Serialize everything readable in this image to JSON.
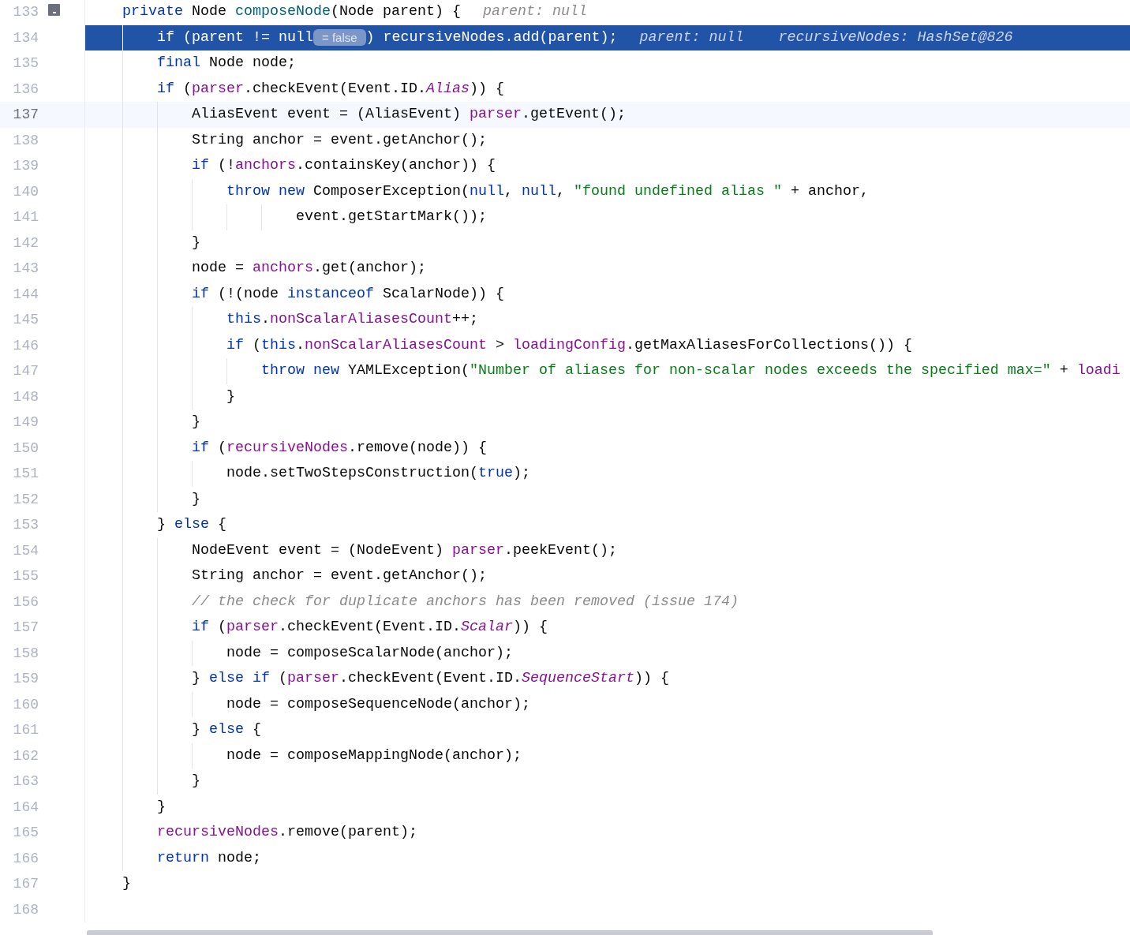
{
  "editor": {
    "lines": [
      {
        "number": "133",
        "executing": false,
        "caret_line": false,
        "gutter_marker": true,
        "segments": [
          {
            "kind": "code",
            "tokens": [
              {
                "kind": "keyword",
                "text": "    private"
              },
              {
                "kind": "plain",
                "text": " Node "
              },
              {
                "kind": "declaration",
                "text": "composeNode"
              },
              {
                "kind": "plain",
                "text": "(Node parent) {"
              }
            ]
          },
          {
            "kind": "inline_value",
            "text": "parent: null"
          }
        ]
      },
      {
        "number": "134",
        "executing": true,
        "caret_line": false,
        "gutter_marker": false,
        "segments": [
          {
            "kind": "code",
            "tokens": [
              {
                "kind": "keyword",
                "text": "        if"
              },
              {
                "kind": "plain",
                "text": " (parent != "
              },
              {
                "kind": "keyword",
                "text": "null"
              }
            ]
          },
          {
            "kind": "chip",
            "text": "= false"
          },
          {
            "kind": "code",
            "tokens": [
              {
                "kind": "plain",
                "text": ") "
              },
              {
                "kind": "field",
                "text": "recursiveNodes"
              },
              {
                "kind": "plain",
                "text": ".add(parent);"
              }
            ]
          },
          {
            "kind": "inline_value",
            "text": "parent: null"
          },
          {
            "kind": "inline_value",
            "text": "recursiveNodes: HashSet@826"
          }
        ]
      },
      {
        "number": "135",
        "executing": false,
        "caret_line": false,
        "gutter_marker": false,
        "segments": [
          {
            "kind": "code",
            "tokens": [
              {
                "kind": "keyword",
                "text": "        final"
              },
              {
                "kind": "plain",
                "text": " Node node;"
              }
            ]
          }
        ]
      },
      {
        "number": "136",
        "executing": false,
        "caret_line": false,
        "gutter_marker": false,
        "segments": [
          {
            "kind": "code",
            "tokens": [
              {
                "kind": "keyword",
                "text": "        if"
              },
              {
                "kind": "plain",
                "text": " ("
              },
              {
                "kind": "field",
                "text": "parser"
              },
              {
                "kind": "plain",
                "text": ".checkEvent(Event.ID."
              },
              {
                "kind": "static",
                "text": "Alias"
              },
              {
                "kind": "plain",
                "text": ")) {"
              }
            ]
          }
        ]
      },
      {
        "number": "137",
        "executing": false,
        "caret_line": true,
        "gutter_marker": false,
        "segments": [
          {
            "kind": "code",
            "tokens": [
              {
                "kind": "plain",
                "text": "            AliasEvent event = (AliasEvent) "
              },
              {
                "kind": "field",
                "text": "parser"
              },
              {
                "kind": "plain",
                "text": ".getEvent();"
              }
            ]
          }
        ]
      },
      {
        "number": "138",
        "executing": false,
        "caret_line": false,
        "gutter_marker": false,
        "segments": [
          {
            "kind": "code",
            "tokens": [
              {
                "kind": "plain",
                "text": "            String anchor = event.getAnchor();"
              }
            ]
          }
        ]
      },
      {
        "number": "139",
        "executing": false,
        "caret_line": false,
        "gutter_marker": false,
        "segments": [
          {
            "kind": "code",
            "tokens": [
              {
                "kind": "keyword",
                "text": "            if"
              },
              {
                "kind": "plain",
                "text": " (!"
              },
              {
                "kind": "field",
                "text": "anchors"
              },
              {
                "kind": "plain",
                "text": ".containsKey(anchor)) {"
              }
            ]
          }
        ]
      },
      {
        "number": "140",
        "executing": false,
        "caret_line": false,
        "gutter_marker": false,
        "segments": [
          {
            "kind": "code",
            "tokens": [
              {
                "kind": "keyword",
                "text": "                throw"
              },
              {
                "kind": "keyword",
                "text": " new"
              },
              {
                "kind": "plain",
                "text": " ComposerException("
              },
              {
                "kind": "keyword",
                "text": "null"
              },
              {
                "kind": "plain",
                "text": ", "
              },
              {
                "kind": "keyword",
                "text": "null"
              },
              {
                "kind": "plain",
                "text": ", "
              },
              {
                "kind": "string",
                "text": "\"found undefined alias \""
              },
              {
                "kind": "plain",
                "text": " + anchor,"
              }
            ]
          }
        ]
      },
      {
        "number": "141",
        "executing": false,
        "caret_line": false,
        "gutter_marker": false,
        "segments": [
          {
            "kind": "code",
            "tokens": [
              {
                "kind": "plain",
                "text": "                        event.getStartMark());"
              }
            ]
          }
        ]
      },
      {
        "number": "142",
        "executing": false,
        "caret_line": false,
        "gutter_marker": false,
        "segments": [
          {
            "kind": "code",
            "tokens": [
              {
                "kind": "plain",
                "text": "            }"
              }
            ]
          }
        ]
      },
      {
        "number": "143",
        "executing": false,
        "caret_line": false,
        "gutter_marker": false,
        "segments": [
          {
            "kind": "code",
            "tokens": [
              {
                "kind": "plain",
                "text": "            node = "
              },
              {
                "kind": "field",
                "text": "anchors"
              },
              {
                "kind": "plain",
                "text": ".get(anchor);"
              }
            ]
          }
        ]
      },
      {
        "number": "144",
        "executing": false,
        "caret_line": false,
        "gutter_marker": false,
        "segments": [
          {
            "kind": "code",
            "tokens": [
              {
                "kind": "keyword",
                "text": "            if"
              },
              {
                "kind": "plain",
                "text": " (!(node "
              },
              {
                "kind": "keyword",
                "text": "instanceof"
              },
              {
                "kind": "plain",
                "text": " ScalarNode)) {"
              }
            ]
          }
        ]
      },
      {
        "number": "145",
        "executing": false,
        "caret_line": false,
        "gutter_marker": false,
        "segments": [
          {
            "kind": "code",
            "tokens": [
              {
                "kind": "keyword",
                "text": "                this"
              },
              {
                "kind": "plain",
                "text": "."
              },
              {
                "kind": "field",
                "text": "nonScalarAliasesCount"
              },
              {
                "kind": "plain",
                "text": "++;"
              }
            ]
          }
        ]
      },
      {
        "number": "146",
        "executing": false,
        "caret_line": false,
        "gutter_marker": false,
        "segments": [
          {
            "kind": "code",
            "tokens": [
              {
                "kind": "keyword",
                "text": "                if"
              },
              {
                "kind": "plain",
                "text": " ("
              },
              {
                "kind": "keyword",
                "text": "this"
              },
              {
                "kind": "plain",
                "text": "."
              },
              {
                "kind": "field",
                "text": "nonScalarAliasesCount"
              },
              {
                "kind": "plain",
                "text": " > "
              },
              {
                "kind": "field",
                "text": "loadingConfig"
              },
              {
                "kind": "plain",
                "text": ".getMaxAliasesForCollections()) {"
              }
            ]
          }
        ]
      },
      {
        "number": "147",
        "executing": false,
        "caret_line": false,
        "gutter_marker": false,
        "segments": [
          {
            "kind": "code",
            "tokens": [
              {
                "kind": "keyword",
                "text": "                    throw"
              },
              {
                "kind": "keyword",
                "text": " new"
              },
              {
                "kind": "plain",
                "text": " YAMLException("
              },
              {
                "kind": "string",
                "text": "\"Number of aliases for non-scalar nodes exceeds the specified max=\""
              },
              {
                "kind": "plain",
                "text": " + "
              },
              {
                "kind": "field",
                "text": "loadi"
              }
            ]
          }
        ]
      },
      {
        "number": "148",
        "executing": false,
        "caret_line": false,
        "gutter_marker": false,
        "segments": [
          {
            "kind": "code",
            "tokens": [
              {
                "kind": "plain",
                "text": "                }"
              }
            ]
          }
        ]
      },
      {
        "number": "149",
        "executing": false,
        "caret_line": false,
        "gutter_marker": false,
        "segments": [
          {
            "kind": "code",
            "tokens": [
              {
                "kind": "plain",
                "text": "            }"
              }
            ]
          }
        ]
      },
      {
        "number": "150",
        "executing": false,
        "caret_line": false,
        "gutter_marker": false,
        "segments": [
          {
            "kind": "code",
            "tokens": [
              {
                "kind": "keyword",
                "text": "            if"
              },
              {
                "kind": "plain",
                "text": " ("
              },
              {
                "kind": "field",
                "text": "recursiveNodes"
              },
              {
                "kind": "plain",
                "text": ".remove(node)) {"
              }
            ]
          }
        ]
      },
      {
        "number": "151",
        "executing": false,
        "caret_line": false,
        "gutter_marker": false,
        "segments": [
          {
            "kind": "code",
            "tokens": [
              {
                "kind": "plain",
                "text": "                node.setTwoStepsConstruction("
              },
              {
                "kind": "keyword",
                "text": "true"
              },
              {
                "kind": "plain",
                "text": ");"
              }
            ]
          }
        ]
      },
      {
        "number": "152",
        "executing": false,
        "caret_line": false,
        "gutter_marker": false,
        "segments": [
          {
            "kind": "code",
            "tokens": [
              {
                "kind": "plain",
                "text": "            }"
              }
            ]
          }
        ]
      },
      {
        "number": "153",
        "executing": false,
        "caret_line": false,
        "gutter_marker": false,
        "segments": [
          {
            "kind": "code",
            "tokens": [
              {
                "kind": "plain",
                "text": "        } "
              },
              {
                "kind": "keyword",
                "text": "else"
              },
              {
                "kind": "plain",
                "text": " {"
              }
            ]
          }
        ]
      },
      {
        "number": "154",
        "executing": false,
        "caret_line": false,
        "gutter_marker": false,
        "segments": [
          {
            "kind": "code",
            "tokens": [
              {
                "kind": "plain",
                "text": "            NodeEvent event = (NodeEvent) "
              },
              {
                "kind": "field",
                "text": "parser"
              },
              {
                "kind": "plain",
                "text": ".peekEvent();"
              }
            ]
          }
        ]
      },
      {
        "number": "155",
        "executing": false,
        "caret_line": false,
        "gutter_marker": false,
        "segments": [
          {
            "kind": "code",
            "tokens": [
              {
                "kind": "plain",
                "text": "            String anchor = event.getAnchor();"
              }
            ]
          }
        ]
      },
      {
        "number": "156",
        "executing": false,
        "caret_line": false,
        "gutter_marker": false,
        "segments": [
          {
            "kind": "code",
            "tokens": [
              {
                "kind": "comment",
                "text": "            // the check for duplicate anchors has been removed (issue 174)"
              }
            ]
          }
        ]
      },
      {
        "number": "157",
        "executing": false,
        "caret_line": false,
        "gutter_marker": false,
        "segments": [
          {
            "kind": "code",
            "tokens": [
              {
                "kind": "keyword",
                "text": "            if"
              },
              {
                "kind": "plain",
                "text": " ("
              },
              {
                "kind": "field",
                "text": "parser"
              },
              {
                "kind": "plain",
                "text": ".checkEvent(Event.ID."
              },
              {
                "kind": "static",
                "text": "Scalar"
              },
              {
                "kind": "plain",
                "text": ")) {"
              }
            ]
          }
        ]
      },
      {
        "number": "158",
        "executing": false,
        "caret_line": false,
        "gutter_marker": false,
        "segments": [
          {
            "kind": "code",
            "tokens": [
              {
                "kind": "plain",
                "text": "                node = composeScalarNode(anchor);"
              }
            ]
          }
        ]
      },
      {
        "number": "159",
        "executing": false,
        "caret_line": false,
        "gutter_marker": false,
        "segments": [
          {
            "kind": "code",
            "tokens": [
              {
                "kind": "plain",
                "text": "            } "
              },
              {
                "kind": "keyword",
                "text": "else"
              },
              {
                "kind": "keyword",
                "text": " if"
              },
              {
                "kind": "plain",
                "text": " ("
              },
              {
                "kind": "field",
                "text": "parser"
              },
              {
                "kind": "plain",
                "text": ".checkEvent(Event.ID."
              },
              {
                "kind": "static",
                "text": "SequenceStart"
              },
              {
                "kind": "plain",
                "text": ")) {"
              }
            ]
          }
        ]
      },
      {
        "number": "160",
        "executing": false,
        "caret_line": false,
        "gutter_marker": false,
        "segments": [
          {
            "kind": "code",
            "tokens": [
              {
                "kind": "plain",
                "text": "                node = composeSequenceNode(anchor);"
              }
            ]
          }
        ]
      },
      {
        "number": "161",
        "executing": false,
        "caret_line": false,
        "gutter_marker": false,
        "segments": [
          {
            "kind": "code",
            "tokens": [
              {
                "kind": "plain",
                "text": "            } "
              },
              {
                "kind": "keyword",
                "text": "else"
              },
              {
                "kind": "plain",
                "text": " {"
              }
            ]
          }
        ]
      },
      {
        "number": "162",
        "executing": false,
        "caret_line": false,
        "gutter_marker": false,
        "segments": [
          {
            "kind": "code",
            "tokens": [
              {
                "kind": "plain",
                "text": "                node = composeMappingNode(anchor);"
              }
            ]
          }
        ]
      },
      {
        "number": "163",
        "executing": false,
        "caret_line": false,
        "gutter_marker": false,
        "segments": [
          {
            "kind": "code",
            "tokens": [
              {
                "kind": "plain",
                "text": "            }"
              }
            ]
          }
        ]
      },
      {
        "number": "164",
        "executing": false,
        "caret_line": false,
        "gutter_marker": false,
        "segments": [
          {
            "kind": "code",
            "tokens": [
              {
                "kind": "plain",
                "text": "        }"
              }
            ]
          }
        ]
      },
      {
        "number": "165",
        "executing": false,
        "caret_line": false,
        "gutter_marker": false,
        "segments": [
          {
            "kind": "code",
            "tokens": [
              {
                "kind": "field",
                "text": "        recursiveNodes"
              },
              {
                "kind": "plain",
                "text": ".remove(parent);"
              }
            ]
          }
        ]
      },
      {
        "number": "166",
        "executing": false,
        "caret_line": false,
        "gutter_marker": false,
        "segments": [
          {
            "kind": "code",
            "tokens": [
              {
                "kind": "keyword",
                "text": "        return"
              },
              {
                "kind": "plain",
                "text": " node;"
              }
            ]
          }
        ]
      },
      {
        "number": "167",
        "executing": false,
        "caret_line": false,
        "gutter_marker": false,
        "segments": [
          {
            "kind": "code",
            "tokens": [
              {
                "kind": "plain",
                "text": "    }"
              }
            ]
          }
        ]
      },
      {
        "number": "168",
        "executing": false,
        "caret_line": false,
        "gutter_marker": false
      }
    ]
  }
}
